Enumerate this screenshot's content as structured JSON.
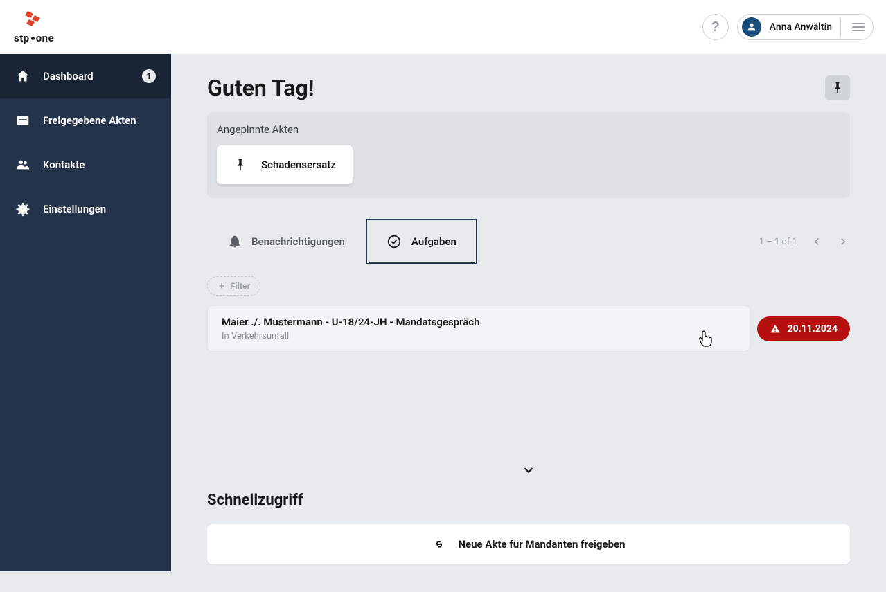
{
  "header": {
    "user_name": "Anna Anwältin",
    "brand": "stp",
    "brand2": "one"
  },
  "sidebar": {
    "items": [
      {
        "label": "Dashboard",
        "badge": "1"
      },
      {
        "label": "Freigegebene Akten"
      },
      {
        "label": "Kontakte"
      },
      {
        "label": "Einstellungen"
      }
    ]
  },
  "main": {
    "greeting": "Guten Tag!",
    "pinned": {
      "title": "Angepinnte Akten",
      "items": [
        {
          "label": "Schadensersatz"
        }
      ]
    },
    "tabs": {
      "notifications": "Benachrichtigungen",
      "tasks": "Aufgaben"
    },
    "pagination": "1 – 1 of 1",
    "filter_label": "Filter",
    "tasks_list": [
      {
        "title": "Maier ./. Mustermann - U-18/24-JH - Mandatsgespräch",
        "subtitle": "In Verkehrsunfall",
        "date": "20.11.2024"
      }
    ],
    "quick": {
      "title": "Schnellzugriff",
      "action": "Neue Akte für Mandanten freigeben"
    }
  }
}
